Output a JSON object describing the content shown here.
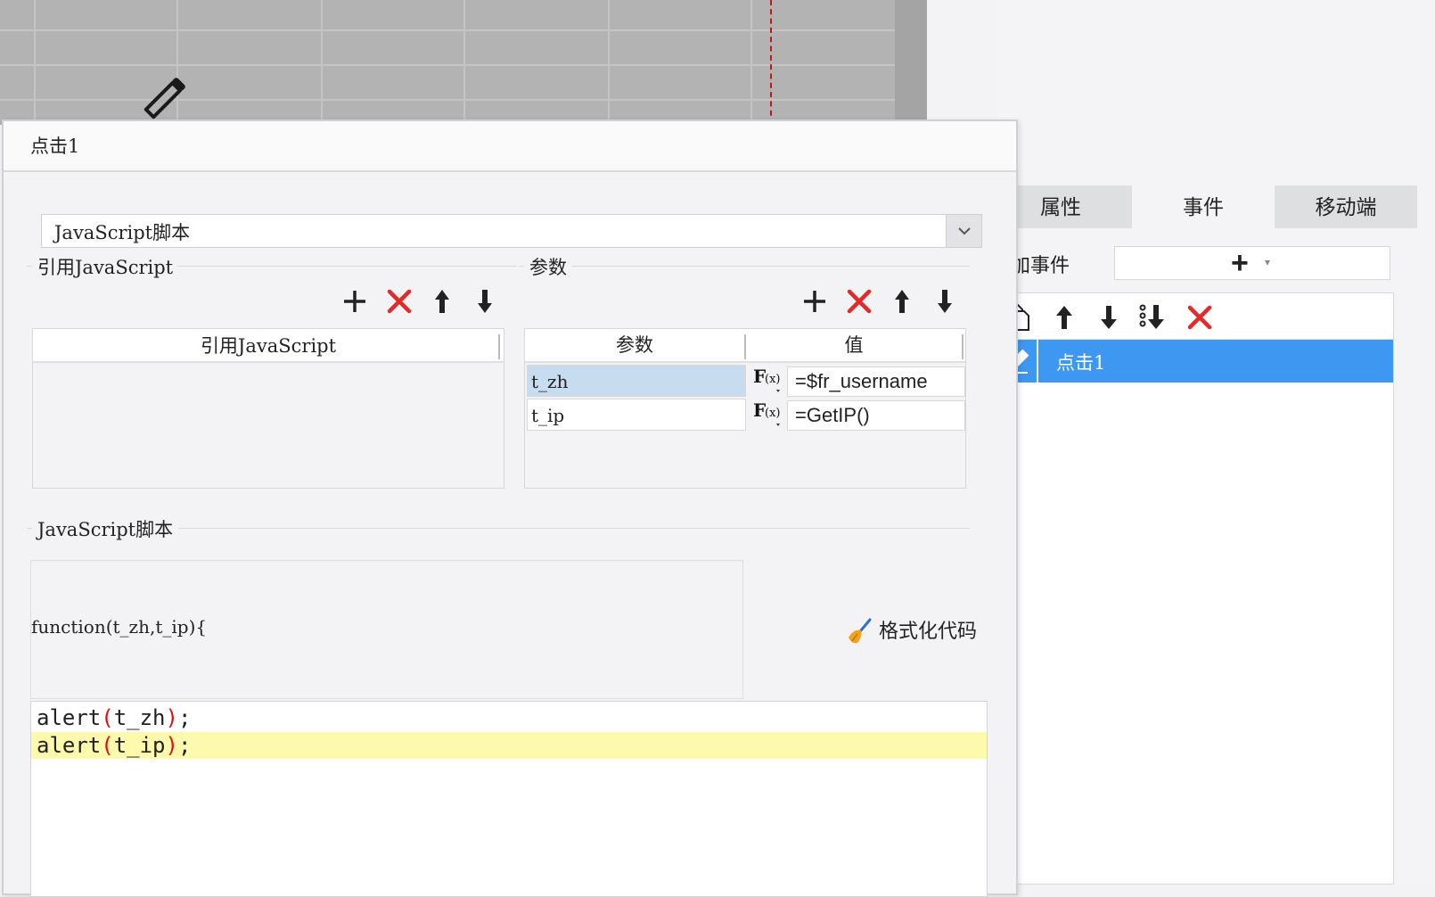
{
  "dialog": {
    "title": "点击1",
    "type_select": "JavaScript脚本",
    "ref_js_section": "引用JavaScript",
    "ref_js_column": "引用JavaScript",
    "params_section": "参数",
    "params_columns": {
      "name": "参数",
      "value": "值"
    },
    "params": [
      {
        "name": "t_zh",
        "value": "=$fr_username"
      },
      {
        "name": "t_ip",
        "value": "=GetIP()"
      }
    ],
    "js_section": "JavaScript脚本",
    "function_header": "function(t_zh,t_ip){",
    "format_label": "格式化代码",
    "code": [
      {
        "fn": "alert",
        "open": "(",
        "arg": "t_zh",
        "close": ")",
        "end": ";"
      },
      {
        "fn": "alert",
        "open": "(",
        "arg": "t_ip",
        "close": ")",
        "end": ";"
      }
    ]
  },
  "right_panel": {
    "tabs": [
      "属性",
      "事件",
      "移动端"
    ],
    "active_tab": "事件",
    "add_event_label": "添加事件",
    "events": [
      "点击1"
    ]
  },
  "colors": {
    "selected_event": "#3e97f0",
    "delete_red": "#e02b2b",
    "highlight_line": "#fdfaae",
    "selected_param": "#c8dcf0"
  },
  "icons": [
    "plus-icon",
    "delete-icon",
    "arrow-up-icon",
    "arrow-down-icon",
    "copy-icon",
    "move-to-bottom-icon",
    "pencil-icon",
    "broom-icon",
    "fx-icon",
    "chevron-down-icon"
  ]
}
